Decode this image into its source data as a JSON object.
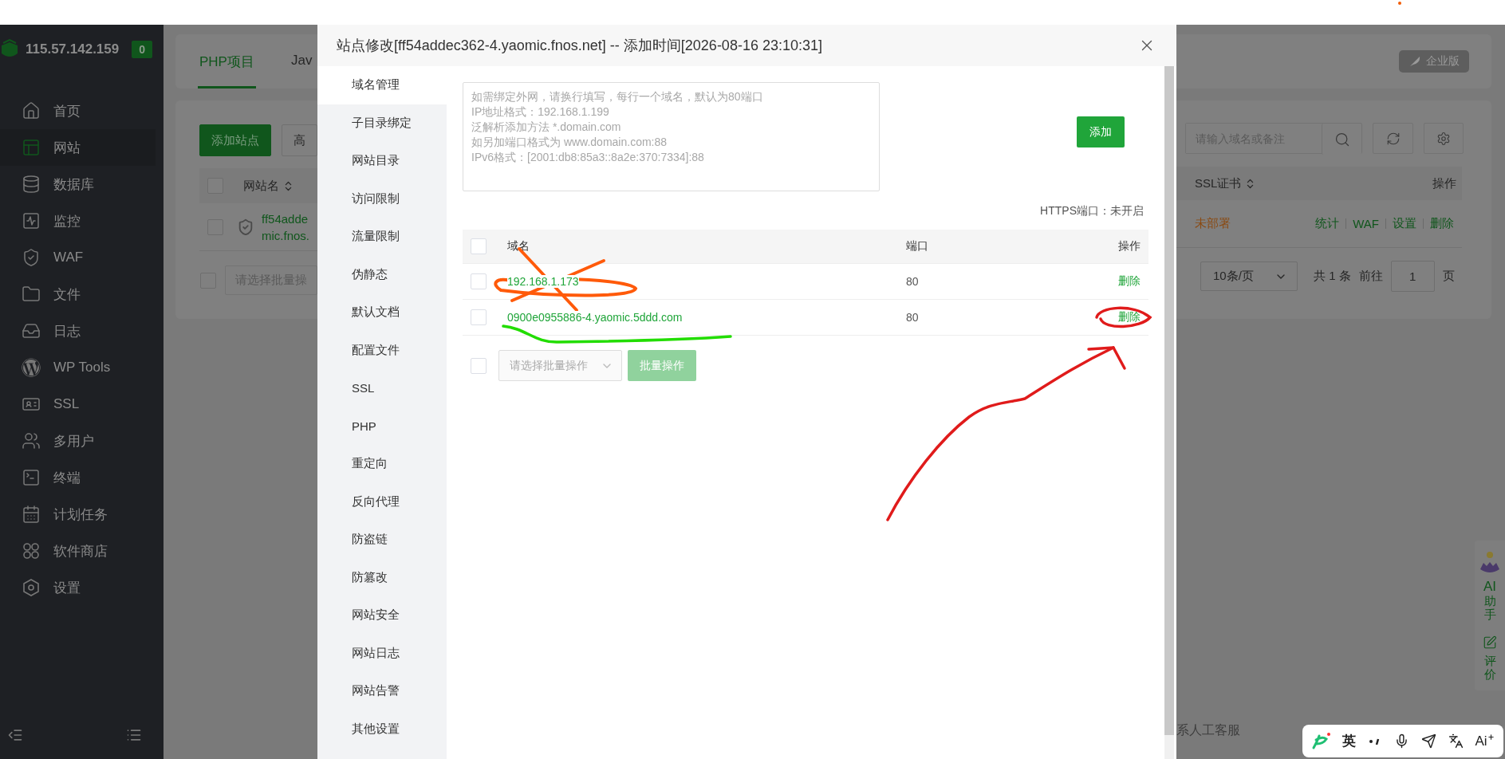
{
  "sidebar": {
    "server_ip": "115.57.142.159",
    "badge": "0",
    "items": [
      {
        "label": "首页",
        "selected": false
      },
      {
        "label": "网站",
        "selected": true
      },
      {
        "label": "数据库",
        "selected": false
      },
      {
        "label": "监控",
        "selected": false
      },
      {
        "label": "WAF",
        "selected": false
      },
      {
        "label": "文件",
        "selected": false
      },
      {
        "label": "日志",
        "selected": false
      },
      {
        "label": "WP Tools",
        "selected": false
      },
      {
        "label": "SSL",
        "selected": false
      },
      {
        "label": "多用户",
        "selected": false
      },
      {
        "label": "终端",
        "selected": false
      },
      {
        "label": "计划任务",
        "selected": false
      },
      {
        "label": "软件商店",
        "selected": false
      },
      {
        "label": "设置",
        "selected": false
      }
    ]
  },
  "background_left": {
    "tabs": [
      {
        "label": "PHP项目",
        "selected": true
      },
      {
        "label": "Jav",
        "selected": false
      }
    ],
    "add_site_button": "添加站点",
    "advanced_button": "高",
    "column": "网站名",
    "select_all_checked": false,
    "site_name_lines": [
      "ff54adde",
      "mic.fnos."
    ],
    "row_checked": false,
    "batch_checked": false,
    "batch_placeholder": "请选择批量操"
  },
  "background_right": {
    "edition_button": "企业版",
    "search": {
      "placeholder": "请输入域名或备注"
    },
    "columns": [
      "SSL证书",
      "操作"
    ],
    "ssl_status": "未部署",
    "actions": [
      "统计",
      "WAF",
      "设置",
      "删除"
    ],
    "pager": {
      "page_size": "10条/页",
      "total": "共 1 条",
      "goto": "前往",
      "page": "1",
      "page_suffix": "页"
    },
    "support_text": "系人工客服"
  },
  "float_panel": {
    "ai_title": "AI",
    "ai_label": "助手",
    "review_label": "评价"
  },
  "ime_toolbar": {
    "language": "英",
    "ai_label": "Ai"
  },
  "modal": {
    "title": "站点修改[ff54addec362-4.yaomic.fnos.net] -- 添加时间[2026-08-16 23:10:31]",
    "menu": [
      {
        "label": "域名管理",
        "selected": true
      },
      {
        "label": "子目录绑定",
        "selected": false
      },
      {
        "label": "网站目录",
        "selected": false
      },
      {
        "label": "访问限制",
        "selected": false
      },
      {
        "label": "流量限制",
        "selected": false
      },
      {
        "label": "伪静态",
        "selected": false
      },
      {
        "label": "默认文档",
        "selected": false
      },
      {
        "label": "配置文件",
        "selected": false
      },
      {
        "label": "SSL",
        "selected": false
      },
      {
        "label": "PHP",
        "selected": false
      },
      {
        "label": "重定向",
        "selected": false
      },
      {
        "label": "反向代理",
        "selected": false
      },
      {
        "label": "防盗链",
        "selected": false
      },
      {
        "label": "防篡改",
        "selected": false
      },
      {
        "label": "网站安全",
        "selected": false
      },
      {
        "label": "网站日志",
        "selected": false
      },
      {
        "label": "网站告警",
        "selected": false
      },
      {
        "label": "其他设置",
        "selected": false
      }
    ],
    "domain_input": {
      "placeholder": "如需绑定外网，请换行填写，每行一个域名，默认为80端口\nIP地址格式：192.168.1.199\n泛解析添加方法 *.domain.com\n如另加端口格式为 www.domain.com:88\nIPv6格式：[2001:db8:85a3::8a2e:370:7334]:88"
    },
    "add_button": "添加",
    "https_status": "HTTPS端口：未开启",
    "columns": [
      "域名",
      "端口",
      "操作"
    ],
    "select_all_checked": false,
    "rows": [
      {
        "domain": "192.168.1.173",
        "port": "80",
        "action": "删除",
        "checked": false
      },
      {
        "domain": "0900e0955886-4.yaomic.5ddd.com",
        "port": "80",
        "action": "删除",
        "checked": false
      }
    ],
    "batch_checked": false,
    "batch_placeholder": "请选择批量操作",
    "batch_button": {
      "label": "批量操作",
      "disabled": true
    }
  }
}
